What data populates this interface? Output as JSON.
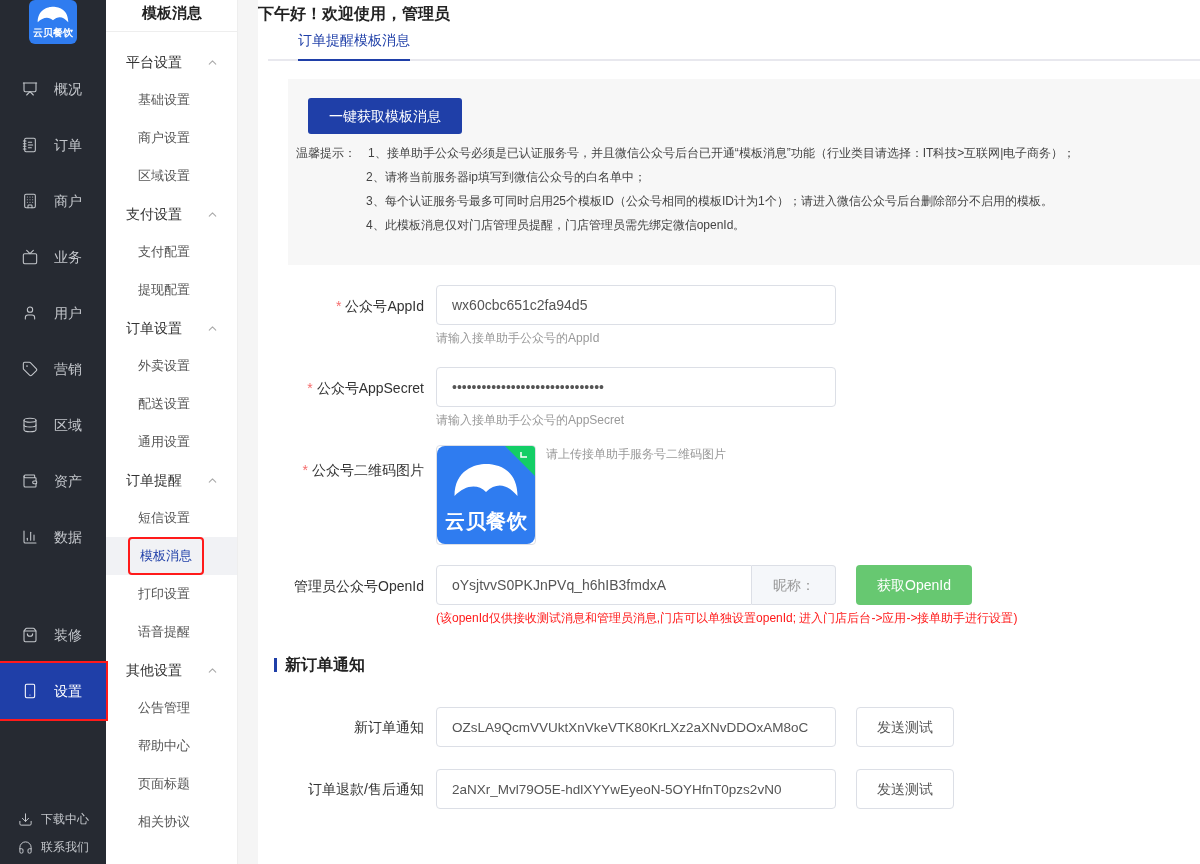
{
  "brand": {
    "logo_text": "云贝餐饮"
  },
  "nav": {
    "items": [
      {
        "label": "概况",
        "selected": false,
        "outlined": false
      },
      {
        "label": "订单",
        "selected": false,
        "outlined": false
      },
      {
        "label": "商户",
        "selected": false,
        "outlined": false
      },
      {
        "label": "业务",
        "selected": false,
        "outlined": false
      },
      {
        "label": "用户",
        "selected": false,
        "outlined": false
      },
      {
        "label": "营销",
        "selected": false,
        "outlined": false
      },
      {
        "label": "区域",
        "selected": false,
        "outlined": false
      },
      {
        "label": "资产",
        "selected": false,
        "outlined": false
      },
      {
        "label": "数据",
        "selected": false,
        "outlined": false
      }
    ],
    "lower_items": [
      {
        "label": "装修",
        "selected": false,
        "outlined": false
      },
      {
        "label": "设置",
        "selected": true,
        "outlined": true
      }
    ],
    "footer": [
      {
        "label": "下载中心"
      },
      {
        "label": "联系我们"
      }
    ]
  },
  "submenu": {
    "title": "模板消息",
    "groups": [
      {
        "label": "平台设置",
        "expanded": true,
        "children": [
          {
            "label": "基础设置",
            "selected": false,
            "outlined": false
          },
          {
            "label": "商户设置",
            "selected": false,
            "outlined": false
          },
          {
            "label": "区域设置",
            "selected": false,
            "outlined": false
          }
        ]
      },
      {
        "label": "支付设置",
        "expanded": true,
        "children": [
          {
            "label": "支付配置",
            "selected": false,
            "outlined": false
          },
          {
            "label": "提现配置",
            "selected": false,
            "outlined": false
          }
        ]
      },
      {
        "label": "订单设置",
        "expanded": true,
        "children": [
          {
            "label": "外卖设置",
            "selected": false,
            "outlined": false
          },
          {
            "label": "配送设置",
            "selected": false,
            "outlined": false
          },
          {
            "label": "通用设置",
            "selected": false,
            "outlined": false
          }
        ]
      },
      {
        "label": "订单提醒",
        "expanded": true,
        "children": [
          {
            "label": "短信设置",
            "selected": false,
            "outlined": false
          },
          {
            "label": "模板消息",
            "selected": true,
            "outlined": true
          },
          {
            "label": "打印设置",
            "selected": false,
            "outlined": false
          },
          {
            "label": "语音提醒",
            "selected": false,
            "outlined": false
          }
        ]
      },
      {
        "label": "其他设置",
        "expanded": true,
        "children": [
          {
            "label": "公告管理",
            "selected": false,
            "outlined": false
          },
          {
            "label": "帮助中心",
            "selected": false,
            "outlined": false
          },
          {
            "label": "页面标题",
            "selected": false,
            "outlined": false
          },
          {
            "label": "相关协议",
            "selected": false,
            "outlined": false
          }
        ]
      }
    ]
  },
  "greeting": "下午好！欢迎使用，管理员",
  "tabs": [
    {
      "label": "订单提醒模板消息",
      "selected": true
    }
  ],
  "notice": {
    "button": "一键获取模板消息",
    "prefix": "温馨提示：",
    "lines": [
      "1、接单助手公众号必须是已认证服务号，并且微信公众号后台已开通“模板消息”功能（行业类目请选择：IT科技>互联网|电子商务）；",
      "2、请将当前服务器ip填写到微信公众号的白名单中；",
      "3、每个认证服务号最多可同时启用25个模板ID（公众号相同的模板ID计为1个）；请进入微信公众号后台删除部分不启用的模板。",
      "4、此模板消息仅对门店管理员提醒，门店管理员需先绑定微信openId。"
    ]
  },
  "form": {
    "required_mark": "*",
    "fields": [
      {
        "kind": "text",
        "label": "公众号AppId",
        "required": true,
        "value": "wx60cbc651c2fa94d5",
        "hint": "请输入接单助手公众号的AppId"
      },
      {
        "kind": "text",
        "label": "公众号AppSecret",
        "required": true,
        "value": "•••••••••••••••••••••••••••••••",
        "hint": "请输入接单助手公众号的AppSecret"
      },
      {
        "kind": "image",
        "label": "公众号二维码图片",
        "required": true,
        "hint": "请上传接单助手服务号二维码图片",
        "image_text": "云贝餐饮",
        "uploaded": true
      },
      {
        "kind": "openid",
        "label": "管理员公众号OpenId",
        "required": false,
        "value": "oYsjtvvS0PKJnPVq_h6hIB3fmdxA",
        "addon": "昵称：",
        "button": "获取OpenId",
        "note": "(该openId仅供接收测试消息和管理员消息,门店可以单独设置openId; 进入门店后台->应用->接单助手进行设置)"
      }
    ]
  },
  "section": {
    "title": "新订单通知",
    "rows": [
      {
        "label": "新订单通知",
        "value": "OZsLA9QcmVVUktXnVkeVTK80KrLXz2aXNvDDOxAM8oC",
        "button": "发送测试"
      },
      {
        "label": "订单退款/售后通知",
        "value": "2aNXr_Mvl79O5E-hdlXYYwEyeoN-5OYHfnT0pzs2vN0",
        "button": "发送测试"
      }
    ]
  }
}
